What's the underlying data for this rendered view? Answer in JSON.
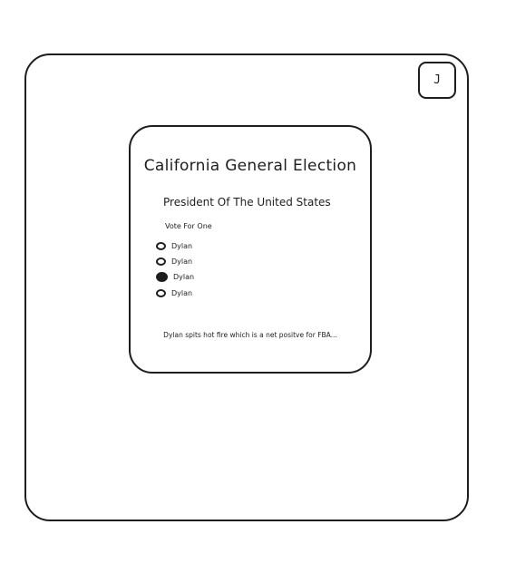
{
  "user": {
    "avatar_initial": "J"
  },
  "ballot": {
    "title": "California General Election",
    "race_title": "President Of The United States",
    "instruction": "Vote For One",
    "candidates": [
      {
        "name": "Dylan",
        "selected": false
      },
      {
        "name": "Dylan",
        "selected": false
      },
      {
        "name": "Dylan",
        "selected": true
      },
      {
        "name": "Dylan",
        "selected": false
      }
    ],
    "bio": "Dylan spits hot fire which is a net positve for FBA..."
  }
}
